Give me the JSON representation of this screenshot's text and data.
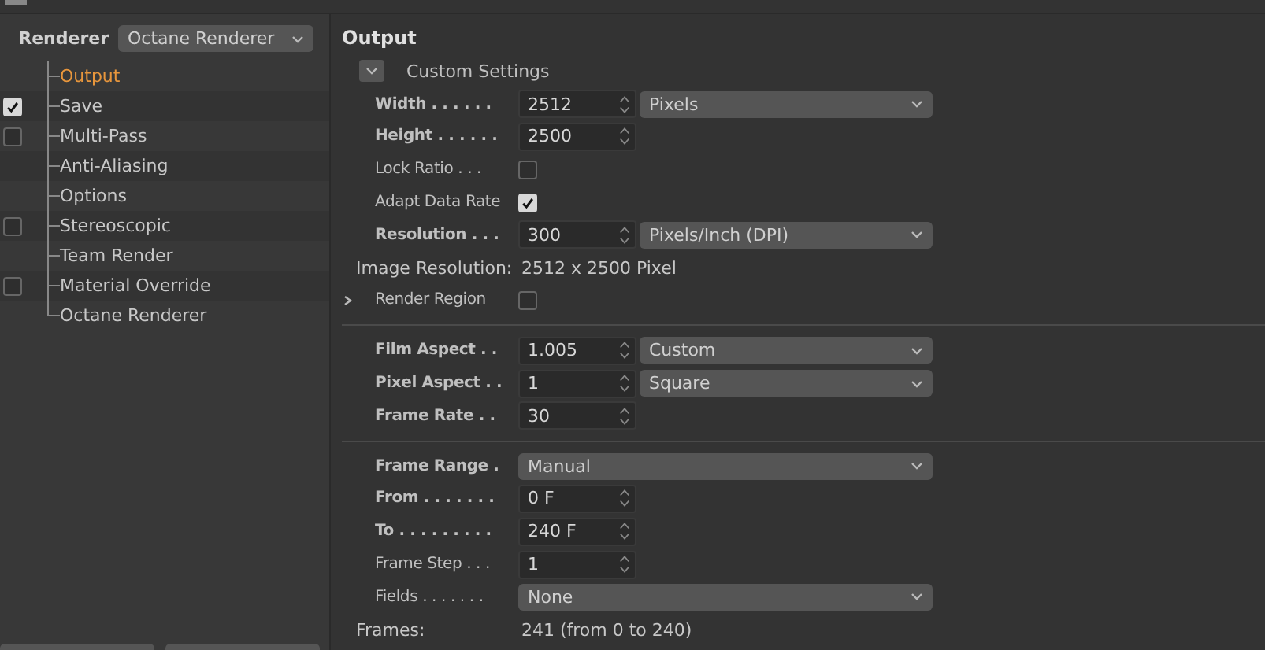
{
  "renderer": {
    "label": "Renderer",
    "value": "Octane Renderer"
  },
  "tree": [
    {
      "label": "Output",
      "selected": true,
      "kind": "plain"
    },
    {
      "label": "Save",
      "selected": false,
      "kind": "check",
      "checked": true
    },
    {
      "label": "Multi-Pass",
      "selected": false,
      "kind": "check",
      "checked": false
    },
    {
      "label": "Anti-Aliasing",
      "selected": false,
      "kind": "plain"
    },
    {
      "label": "Options",
      "selected": false,
      "kind": "plain"
    },
    {
      "label": "Stereoscopic",
      "selected": false,
      "kind": "check",
      "checked": false
    },
    {
      "label": "Team Render",
      "selected": false,
      "kind": "plain"
    },
    {
      "label": "Material Override",
      "selected": false,
      "kind": "check",
      "checked": false
    },
    {
      "label": "Octane Renderer",
      "selected": false,
      "kind": "plain"
    }
  ],
  "panel": {
    "title": "Output",
    "sections": [
      [
        {
          "kind": "toggle",
          "label": "Custom Settings",
          "expanded": true
        },
        {
          "kind": "number",
          "label": "Width . . . . . .",
          "bold": true,
          "value": "2512",
          "unit": "Pixels"
        },
        {
          "kind": "number",
          "label": "Height . . . . . .",
          "bold": true,
          "value": "2500"
        },
        {
          "kind": "checkbox",
          "label": "Lock Ratio . . .",
          "bold": false,
          "checked": false
        },
        {
          "kind": "checkbox",
          "label": "Adapt Data Rate",
          "bold": false,
          "checked": true
        },
        {
          "kind": "number",
          "label": "Resolution . . .",
          "bold": true,
          "value": "300",
          "unit": "Pixels/Inch (DPI)"
        },
        {
          "kind": "info",
          "label": "Image Resolution:",
          "value": "2512 x 2500 Pixel"
        },
        {
          "kind": "expander",
          "label": "Render Region",
          "expanded": false,
          "checked": false
        }
      ],
      [
        {
          "kind": "number",
          "label": "Film Aspect . .",
          "bold": true,
          "value": "1.005",
          "unit": "Custom"
        },
        {
          "kind": "number",
          "label": "Pixel Aspect . .",
          "bold": true,
          "value": "1",
          "unit": "Square"
        },
        {
          "kind": "number",
          "label": "Frame Rate . .",
          "bold": true,
          "value": "30"
        }
      ],
      [
        {
          "kind": "dropdown",
          "label": "Frame Range .",
          "bold": true,
          "value": "Manual"
        },
        {
          "kind": "number",
          "label": "From . . . . . . .",
          "bold": true,
          "value": "0 F"
        },
        {
          "kind": "number",
          "label": "To . . . . . . . . .",
          "bold": true,
          "value": "240 F"
        },
        {
          "kind": "number",
          "label": "Frame Step . . .",
          "bold": false,
          "value": "1"
        },
        {
          "kind": "dropdown",
          "label": "Fields . . . . . . .",
          "bold": false,
          "value": "None"
        },
        {
          "kind": "info",
          "label": "Frames:",
          "value": "241 (from 0 to 240)"
        }
      ]
    ]
  }
}
